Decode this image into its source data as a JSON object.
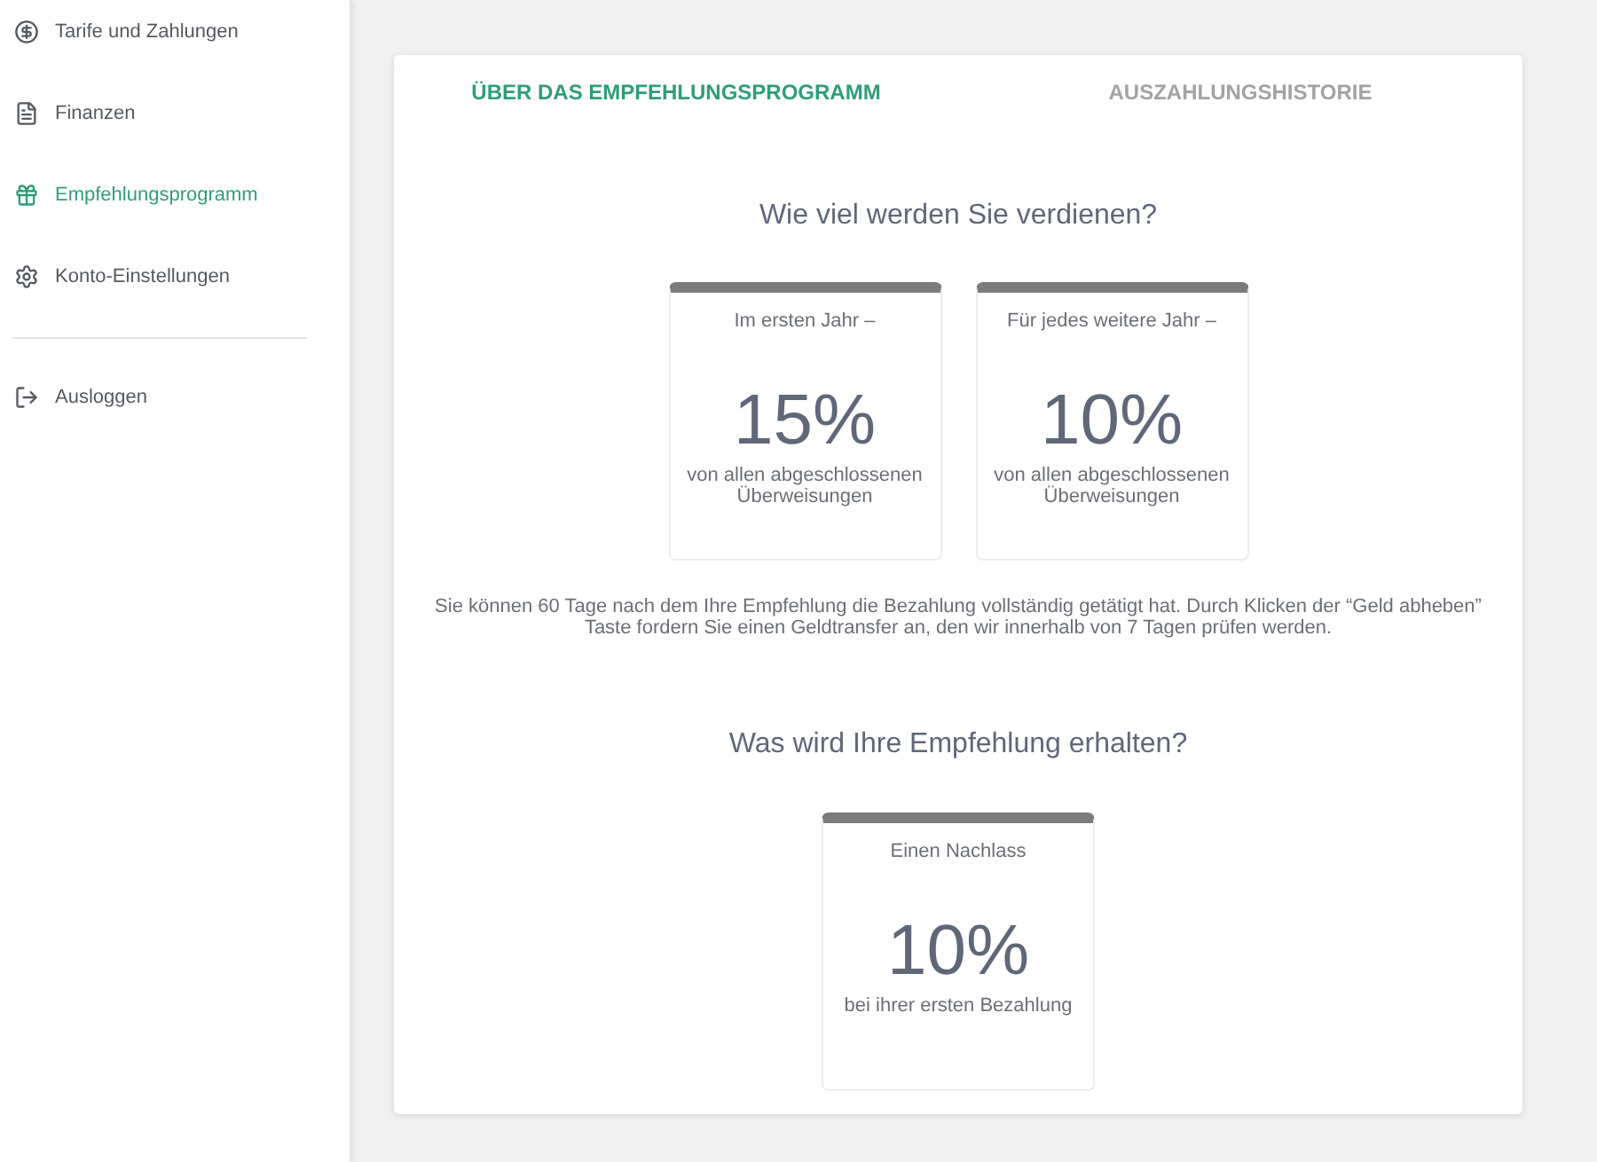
{
  "sidebar": {
    "items": [
      {
        "kind": "pricing",
        "label": "Tarife und Zahlungen",
        "selected": false
      },
      {
        "kind": "finance",
        "label": "Finanzen",
        "selected": false
      },
      {
        "kind": "referral",
        "label": "Empfehlungsprogramm",
        "selected": true
      },
      {
        "kind": "settings",
        "label": "Konto-Einstellungen",
        "selected": false
      }
    ],
    "logout": {
      "label": "Ausloggen"
    }
  },
  "tabs": [
    {
      "label": "ÜBER DAS EMPFEHLUNGSPROGRAMM",
      "selected": true
    },
    {
      "label": "AUSZAHLUNGSHISTORIE",
      "selected": false
    }
  ],
  "sections": [
    {
      "heading": "Wie viel werden Sie verdienen?",
      "cards": [
        {
          "caption": "Im ersten Jahr –",
          "value": "15%",
          "description": "von allen abgeschlossenen Überweisungen"
        },
        {
          "caption": "Für jedes weitere Jahr –",
          "value": "10%",
          "description": "von allen abgeschlossenen Überweisungen"
        }
      ],
      "note": "Sie können 60 Tage nach dem Ihre Empfehlung die Bezahlung vollständig getätigt hat. Durch Klicken der “Geld abheben” Taste fordern Sie einen Geldtransfer an, den wir innerhalb von 7 Tagen prüfen werden."
    },
    {
      "heading": "Was wird Ihre Empfehlung erhalten?",
      "cards": [
        {
          "caption": "Einen Nachlass",
          "value": "10%",
          "description": "bei ihrer ersten Bezahlung"
        }
      ]
    }
  ]
}
